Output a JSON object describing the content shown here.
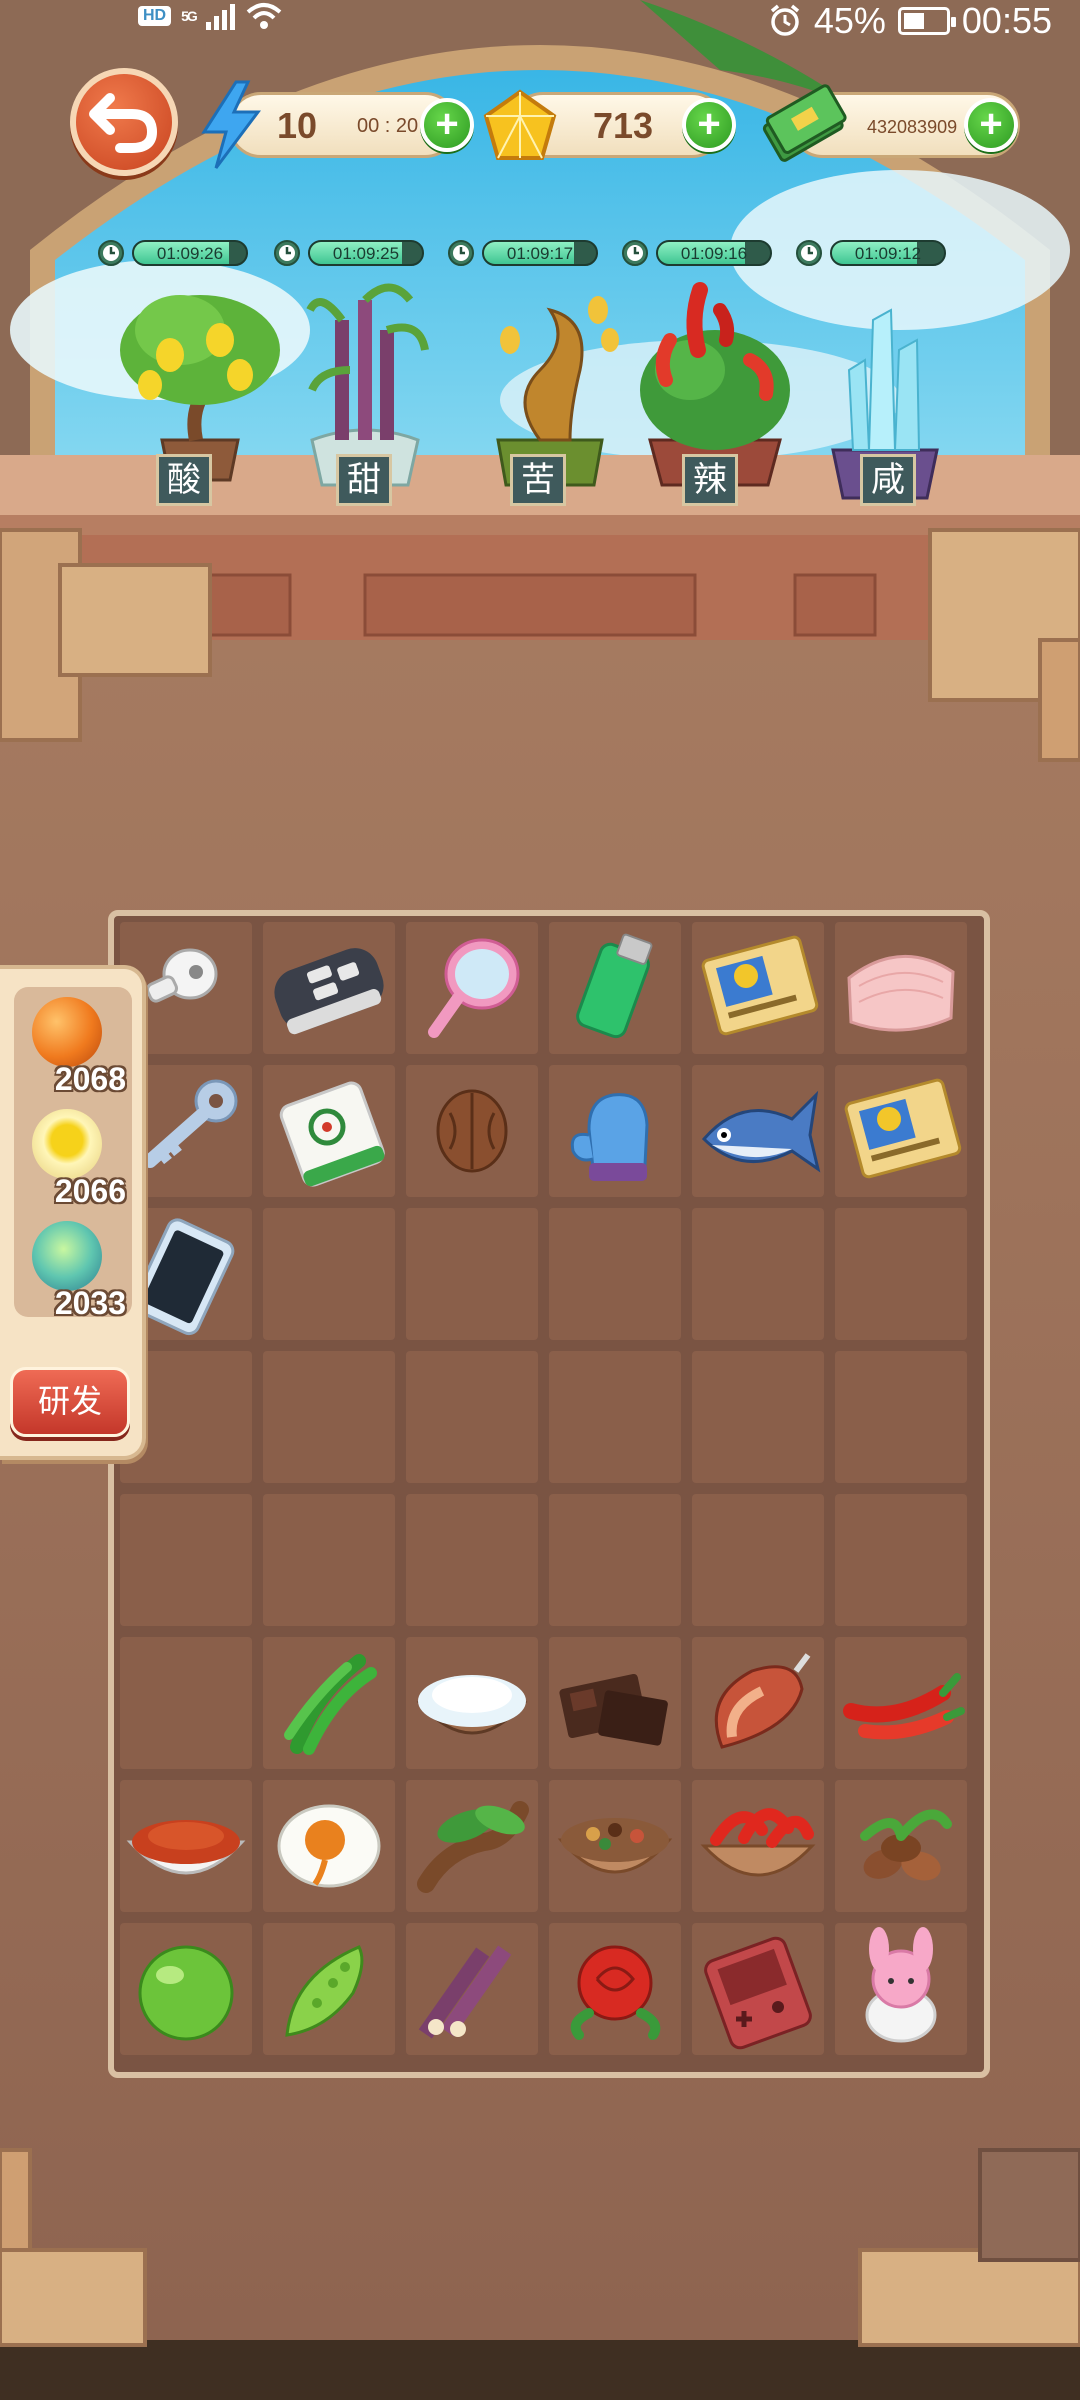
{
  "status_bar": {
    "network_badge": "HD",
    "network_type": "5G",
    "battery_percent": "45%",
    "battery_level": 0.45,
    "time": "00:55"
  },
  "top_bar": {
    "energy": {
      "value": "10",
      "timer": "00 : 20",
      "icon": "lightning-icon"
    },
    "gems": {
      "value": "713",
      "icon": "gem-icon"
    },
    "cash": {
      "value": "432083909",
      "icon": "cash-icon"
    }
  },
  "plants": [
    {
      "label": "酸",
      "timer": "01:09:26",
      "progress": 0.85,
      "icon": "lemon-tree-icon"
    },
    {
      "label": "甜",
      "timer": "01:09:25",
      "progress": 0.82,
      "icon": "sugarcane-plant-icon"
    },
    {
      "label": "苦",
      "timer": "01:09:17",
      "progress": 0.8,
      "icon": "bitter-tree-icon"
    },
    {
      "label": "辣",
      "timer": "01:09:16",
      "progress": 0.78,
      "icon": "chili-plant-icon"
    },
    {
      "label": "咸",
      "timer": "01:09:12",
      "progress": 0.76,
      "icon": "salt-crystal-icon"
    }
  ],
  "side_panel": {
    "items": [
      {
        "count": "2068",
        "icon": "orange-orb-icon",
        "color": "#f07a1e"
      },
      {
        "count": "2066",
        "icon": "yellow-orb-icon",
        "color": "#f3d23a"
      },
      {
        "count": "2033",
        "icon": "green-swirl-orb-icon",
        "color": "#5fc6b0"
      }
    ],
    "research_label": "研发"
  },
  "board": {
    "rows": [
      [
        "earbud-icon",
        "car-key-icon",
        "hand-mirror-icon",
        "lighter-icon",
        "trading-card-icon",
        "pink-bag-icon"
      ],
      [
        "key-icon",
        "mahjong-tile-icon",
        "walnut-icon",
        "glove-icon",
        "fish-icon",
        "trading-card-icon"
      ],
      [
        "smartphone-icon",
        "",
        "",
        "",
        "",
        ""
      ],
      [
        "",
        "",
        "",
        "",
        "",
        ""
      ],
      [
        "",
        "",
        "",
        "",
        "",
        ""
      ],
      [
        "",
        "green-pepper-icon",
        "salt-bowl-icon",
        "chocolate-icon",
        "ham-icon",
        "red-chili-icon"
      ],
      [
        "chili-powder-bowl-icon",
        "salted-egg-icon",
        "tamarind-icon",
        "spice-bowl-icon",
        "chili-bowl-icon",
        "coffee-beans-icon"
      ],
      [
        "lime-icon",
        "bitter-melon-icon",
        "sugarcane-icon",
        "rose-icon",
        "game-console-icon",
        "plush-toy-icon"
      ]
    ]
  }
}
